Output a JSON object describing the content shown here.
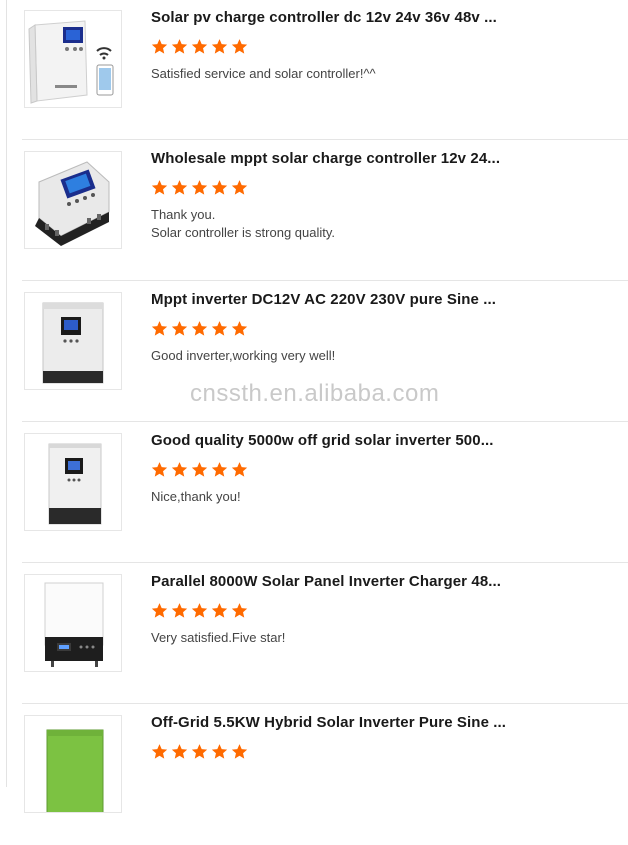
{
  "watermark": "cnssth.en.alibaba.com",
  "colors": {
    "star": "#ff6a00",
    "divider": "#e5e5e5"
  },
  "reviews": [
    {
      "title": "Solar pv charge controller dc 12v 24v 36v 48v ...",
      "rating": 5,
      "comment_lines": [
        "Satisfied service and solar controller!^^"
      ],
      "thumb_icon": "solar-charge-controller-wifi-product-image"
    },
    {
      "title": "Wholesale mppt solar charge controller 12v 24...",
      "rating": 5,
      "comment_lines": [
        "Thank you.",
        "Solar controller is strong quality."
      ],
      "thumb_icon": "mppt-charge-controller-product-image"
    },
    {
      "title": "Mppt inverter DC12V AC 220V 230V pure Sine ...",
      "rating": 5,
      "comment_lines": [
        "Good inverter,working very well!"
      ],
      "thumb_icon": "inverter-product-image"
    },
    {
      "title": "Good quality 5000w off grid solar inverter 500...",
      "rating": 5,
      "comment_lines": [
        "Nice,thank you!"
      ],
      "thumb_icon": "off-grid-inverter-product-image"
    },
    {
      "title": "Parallel 8000W Solar Panel Inverter Charger 48...",
      "rating": 5,
      "comment_lines": [
        "Very satisfied.Five star!"
      ],
      "thumb_icon": "parallel-inverter-product-image"
    },
    {
      "title": "Off-Grid 5.5KW Hybrid Solar Inverter Pure Sine ...",
      "rating": 5,
      "comment_lines": [],
      "thumb_icon": "hybrid-inverter-product-image"
    }
  ]
}
